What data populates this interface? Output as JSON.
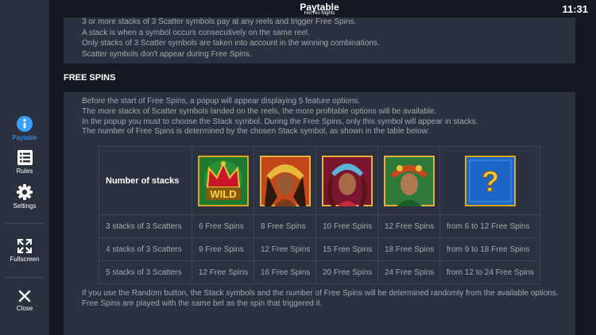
{
  "header": {
    "title": "Paytable",
    "subtitle": "Hot Rio Nights",
    "clock": "11:31"
  },
  "sidebar": {
    "items": [
      {
        "label": "Paytable",
        "icon": "info-icon",
        "active": true
      },
      {
        "label": "Rules",
        "icon": "list-icon"
      },
      {
        "label": "Settings",
        "icon": "gear-icon"
      },
      {
        "label": "Fullscreen",
        "icon": "fullscreen-icon"
      },
      {
        "label": "Close",
        "icon": "close-icon"
      }
    ]
  },
  "scatter_text": [
    "3 or more stacks of 3 Scatter symbols pay at any reels and trigger Free Spins.",
    "A stack is when a symbol occurs consecutively on the same reel.",
    "Only stacks of 3 Scatter symbols are taken into account in the winning combinations.",
    "Scatter symbols don't appear during Free Spins."
  ],
  "free_spins": {
    "title": "FREE SPINS",
    "intro": [
      "Before the start of Free Spins, a popup will appear displaying 5 feature options.",
      "The more stacks of Scatter symbols landed on the reels, the more profitable options will be available.",
      "In the popup you must to choose the Stack symbol. During the Free Spins, only this symbol will appear in stacks.",
      "The number of Free Spins is determined by the chosen Stack symbol, as shown in the table below:"
    ],
    "table": {
      "header_label": "Number of stacks",
      "symbols": [
        "wild-crown-symbol",
        "dancer-gold-symbol",
        "dancer-red-symbol",
        "dancer-green-symbol",
        "mystery-question-symbol"
      ],
      "symbol_text": {
        "wild": "WILD",
        "mystery": "?"
      },
      "rows": [
        [
          "3 stacks of 3 Scatters",
          "6 Free Spins",
          "8 Free Spins",
          "10 Free Spins",
          "12 Free Spins",
          "from 6 to 12 Free Spins"
        ],
        [
          "4 stacks of 3 Scatters",
          "9 Free Spins",
          "12 Free Spins",
          "15 Free Spins",
          "18 Free Spins",
          "from 9 to 18 Free Spins"
        ],
        [
          "5 stacks of 3 Scatters",
          "12 Free Spins",
          "16 Free Spins",
          "20 Free Spins",
          "24 Free Spins",
          "from 12 to 24 Free Spins"
        ]
      ]
    },
    "outro": [
      "If you use the Random button, the Stack symbols and the number of Free Spins will be determined randomly from the available options.",
      "Free Spins are played with the same bet as the spin that triggered it."
    ]
  },
  "colors": {
    "background": "#151923",
    "panel": "#2b313e",
    "accent": "#3aa0ff",
    "text_muted": "#a4a8b2"
  }
}
